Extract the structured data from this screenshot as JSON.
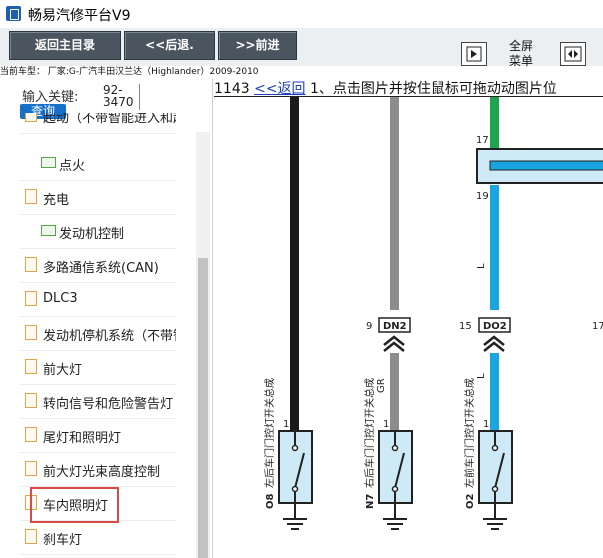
{
  "window": {
    "title": "畅易汽修平台V9"
  },
  "toolbar": {
    "back_main": "返回主目录",
    "back": "<<后退.",
    "forward": ">>前进",
    "fullscreen_line1": "全屏",
    "fullscreen_line2": "菜单"
  },
  "current_car": "当前车型： 厂家:G-广汽丰田汉兰达（Highlander）2009-2010",
  "search": {
    "label": "输入关键:",
    "value": "92-3470",
    "button": "查询"
  },
  "tree": [
    {
      "label": "起动（不带智能进入和起动",
      "icon": "document-icon",
      "indent": false
    },
    {
      "label": "点火",
      "icon": "folder-icon",
      "indent": true
    },
    {
      "label": "充电",
      "icon": "document-icon",
      "indent": false
    },
    {
      "label": "发动机控制",
      "icon": "folder-icon",
      "indent": true
    },
    {
      "label": "多路通信系统(CAN)",
      "icon": "document-icon",
      "indent": false
    },
    {
      "label": "DLC3",
      "icon": "document-icon",
      "indent": false
    },
    {
      "label": "发动机停机系统（不带智能",
      "icon": "document-icon",
      "indent": false
    },
    {
      "label": "前大灯",
      "icon": "document-icon",
      "indent": false
    },
    {
      "label": "转向信号和危险警告灯",
      "icon": "document-icon",
      "indent": false
    },
    {
      "label": "尾灯和照明灯",
      "icon": "document-icon",
      "indent": false
    },
    {
      "label": "前大灯光束高度控制",
      "icon": "document-icon",
      "indent": false
    },
    {
      "label": "车内照明灯",
      "icon": "document-icon",
      "indent": false,
      "highlighted": true
    },
    {
      "label": "刹车灯",
      "icon": "document-icon",
      "indent": false
    }
  ],
  "content": {
    "page_number": "1143",
    "back_link": "<<返回",
    "instruction": "1、点击图片并按住鼠标可拖动动图片位"
  },
  "diagram": {
    "connectors": [
      {
        "pin": "9",
        "code": "DN2"
      },
      {
        "pin": "15",
        "code": "DO2"
      },
      {
        "pin": "17",
        "code": ""
      }
    ],
    "wire_colors": [
      "GR",
      "L",
      "L"
    ],
    "top_pins": [
      "17",
      "19"
    ],
    "switches": [
      {
        "pin": "1",
        "code": "O8",
        "desc": "左后车门门控灯开关总成"
      },
      {
        "pin": "1",
        "code": "N7",
        "desc": "右后车门门控灯开关总成"
      },
      {
        "pin": "1",
        "code": "O2",
        "desc": "左前车门门控灯开关总成"
      }
    ],
    "colors": {
      "black_wire": "#1a1a1a",
      "gray_wire": "#8c8c8c",
      "blue_wire": "#1aa5e0",
      "green_wire": "#1ea34f"
    }
  }
}
